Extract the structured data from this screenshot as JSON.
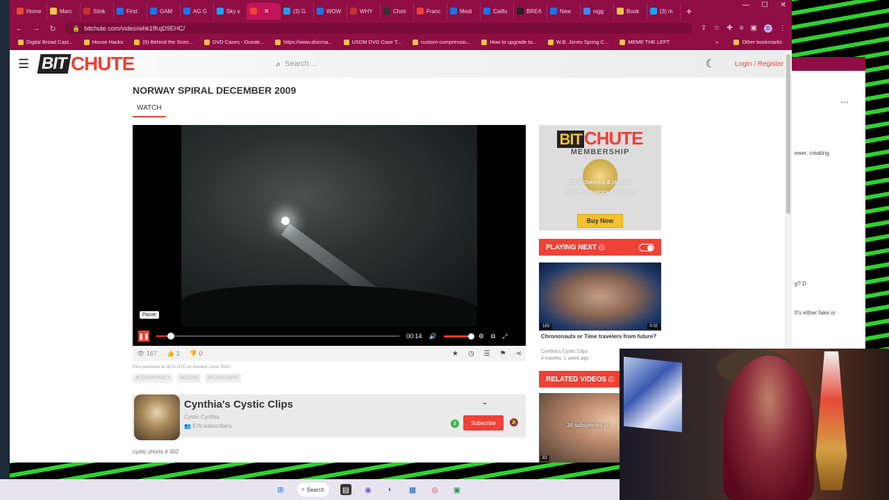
{
  "browser": {
    "tabs": [
      {
        "label": "Home",
        "color": "#e34c26"
      },
      {
        "label": "Marc",
        "color": "#f2c14e"
      },
      {
        "label": "Stink",
        "color": "#c9302c"
      },
      {
        "label": "First",
        "color": "#1a73e8"
      },
      {
        "label": "GAM",
        "color": "#1a73e8"
      },
      {
        "label": "AG G",
        "color": "#1a73e8"
      },
      {
        "label": "Sky s",
        "color": "#1da1f2"
      },
      {
        "label": "",
        "color": "#ef4136",
        "active": true
      },
      {
        "label": "(3) G",
        "color": "#1da1f2"
      },
      {
        "label": "WOW",
        "color": "#1a73e8"
      },
      {
        "label": "WHY",
        "color": "#c4302b"
      },
      {
        "label": "Chris",
        "color": "#333333"
      },
      {
        "label": "Franc",
        "color": "#ef4136"
      },
      {
        "label": "Medi",
        "color": "#1a73e8"
      },
      {
        "label": "Califo",
        "color": "#1a73e8"
      },
      {
        "label": "BREA",
        "color": "#222222"
      },
      {
        "label": "New",
        "color": "#1a73e8"
      },
      {
        "label": "nigg",
        "color": "#4285f4"
      },
      {
        "label": "Book",
        "color": "#f2c14e"
      },
      {
        "label": "(3) m",
        "color": "#1da1f2"
      }
    ],
    "url": "bitchute.com/video/whk1fKqD9EHC/",
    "bookmarks": [
      "Digital Broad Cast...",
      "House Hacks",
      "(9) Behind the Scen...",
      "DVD Cases - Duode...",
      "https://www.discma...",
      "USDM DVD Case T...",
      "custom-compressio...",
      "How to upgrade to...",
      "W.B. Jones Spring C...",
      "MEME THE LEFT"
    ],
    "bookmarks_more": "»",
    "other_bookmarks": "Other bookmarks"
  },
  "site": {
    "logo_bit": "BIT",
    "logo_chute": "CHUTE",
    "search_placeholder": "Search ...",
    "login": "Login / Register"
  },
  "video": {
    "title": "NORWAY SPIRAL DECEMBER 2009",
    "tab_watch": "WATCH",
    "tooltip": "Pause",
    "current_time": "00:14",
    "progress_pct": 6,
    "volume_pct": 100,
    "views": "167",
    "likes": "1",
    "dislikes": "0",
    "published": "First published at 06:51 UTC on October 22nd, 2022.",
    "tags": [
      "#CONSPIRACY",
      "#COVID",
      "#FLATEARTH"
    ],
    "description": "cystic shorts # 302"
  },
  "channel": {
    "name": "Cynthia's Cystic Clips",
    "handle": "Cystic Cynthia",
    "subscribers": "676 subscribers",
    "subscribe_label": "Subscribe"
  },
  "sidebar": {
    "mem_bit": "BIT",
    "mem_chute": "CHUTE",
    "mem_title": "MEMBERSHIP",
    "mem_line1": "Extra channels & playlists",
    "mem_line2": "Exclusive badges & rewards",
    "buy_now": "Buy Now",
    "playing_next": "PLAYING NEXT",
    "next_views": "183",
    "next_duration": "0:32",
    "next_title": "Chrononauts or Time travelers from future?",
    "next_channel": "Cynthia's Cystic Clips",
    "next_age": "4 months, 1 week ago",
    "related": "RELATED VIDEOS",
    "rel_text": "38 subspecies of",
    "rel_views": "83"
  },
  "bg_window": {
    "text1": "ewer, creating",
    "text2": "g? D",
    "text3": "It's either fake or"
  },
  "taskbar": {
    "search_label": "Search"
  },
  "colors": {
    "brand_red": "#ef4136",
    "browser_theme": "#8f0e45"
  }
}
